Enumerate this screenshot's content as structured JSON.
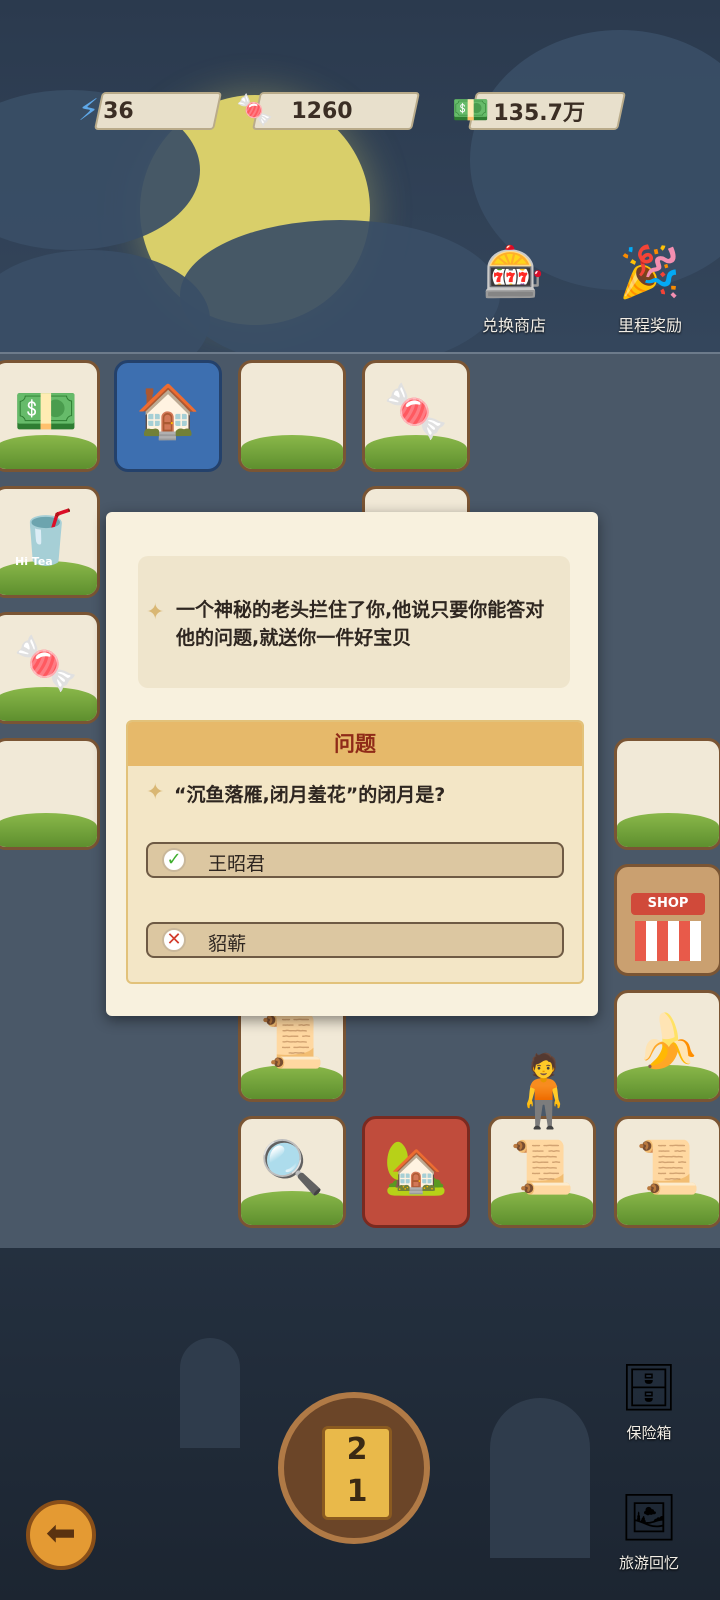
{
  "resources": {
    "energy": {
      "icon": "lightning-icon",
      "value": "36"
    },
    "candy": {
      "icon": "candy-icon",
      "value": "1260"
    },
    "cash": {
      "icon": "cash-stack-icon",
      "value": "135.7万"
    }
  },
  "top_buttons": {
    "exchange_shop": {
      "icon": "gumball-machine-icon",
      "label": "兑换商店"
    },
    "milestone_reward": {
      "icon": "party-popper-icon",
      "label": "里程奖励"
    }
  },
  "dialog": {
    "story": "一个神秘的老头拦住了你,他说只要你能答对他的问题,就送你一件好宝贝",
    "question_title": "问题",
    "question": "“沉鱼落雁,闭月羞花”的闭月是?",
    "options": [
      {
        "label": "王昭君",
        "state": "correct"
      },
      {
        "label": "貂蕲",
        "state": "wrong"
      }
    ]
  },
  "tiles": {
    "shop_sign": "SHOP",
    "tea_label": "Hi Tea"
  },
  "dice": {
    "top": "2",
    "bottom": "1"
  },
  "side_buttons": {
    "safe": {
      "icon": "safe-icon",
      "label": "保险箱"
    },
    "travel_memory": {
      "icon": "photo-frame-icon",
      "label": "旅游回忆"
    }
  },
  "colors": {
    "accent_title": "#8f2a18",
    "option_bg": "#dcc7a1",
    "dialog_bg": "#f8f1de"
  }
}
